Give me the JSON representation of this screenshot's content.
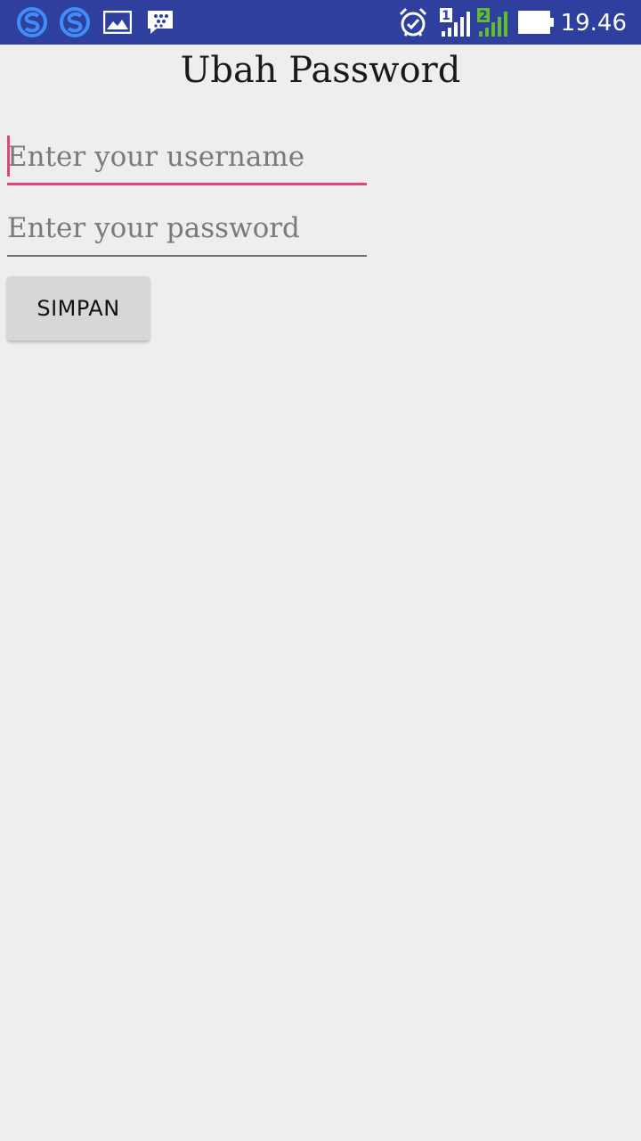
{
  "status_bar": {
    "time": "19.46",
    "sim1_label": "1",
    "sim2_label": "2",
    "icons": [
      "s-app-icon",
      "s-app-icon",
      "gallery-icon",
      "bbm-icon",
      "alarm-icon",
      "signal-sim1-icon",
      "signal-sim2-icon",
      "battery-icon"
    ],
    "colors": {
      "bar": "#2f3f9e",
      "app_icon": "#3f8ef5",
      "sim2": "#5fbf2f"
    }
  },
  "page": {
    "title": "Ubah Password"
  },
  "form": {
    "username": {
      "placeholder": "Enter your username",
      "value": ""
    },
    "password": {
      "placeholder": "Enter your password",
      "value": ""
    },
    "submit_label": "SIMPAN"
  },
  "colors": {
    "accent": "#e0457b",
    "background": "#eeeeee",
    "button": "#d6d7d7"
  }
}
